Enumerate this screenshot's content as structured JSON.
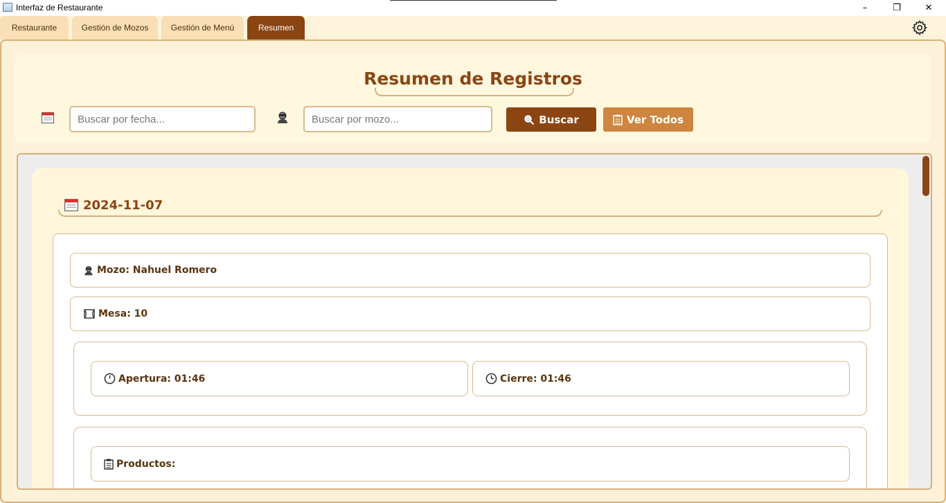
{
  "window": {
    "title": "Interfaz de Restaurante",
    "minimize": "–",
    "maximize": "❐",
    "close": "✕"
  },
  "tabs": [
    {
      "label": "Restaurante"
    },
    {
      "label": "Gestión de Mozos"
    },
    {
      "label": "Gestión de Menú"
    },
    {
      "label": "Resumen",
      "active": true
    }
  ],
  "header": {
    "title": "Resumen de Registros"
  },
  "search": {
    "date_placeholder": "Buscar por fecha...",
    "waiter_placeholder": "Buscar por mozo...",
    "search_button": "Buscar",
    "view_all_button": "Ver Todos"
  },
  "records": [
    {
      "date": "2024-11-07",
      "waiter": "Mozo: Nahuel Romero",
      "table": "Mesa: 10",
      "opening": "Apertura: 01:46",
      "closing": "Cierre: 01:46",
      "products_label": "Productos:"
    }
  ],
  "colors": {
    "accent": "#8b4513",
    "secondary": "#cd853f",
    "background": "#fdf3dc",
    "border": "#d9b07a"
  },
  "icons": {
    "calendar": "calendar-icon",
    "waiter": "waiter-icon",
    "table": "table-icon",
    "clock": "clock-icon",
    "clipboard": "clipboard-icon",
    "search": "magnifier-icon",
    "settings": "gear-icon"
  }
}
